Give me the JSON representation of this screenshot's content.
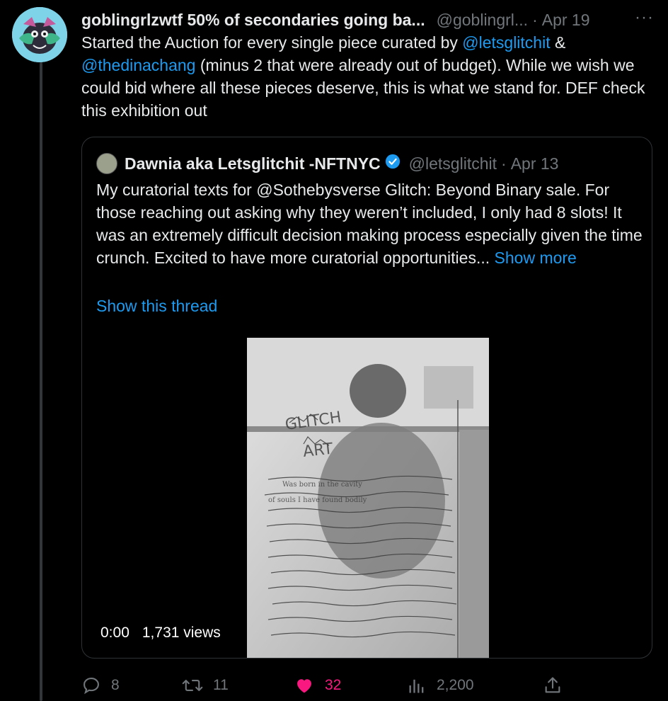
{
  "tweet": {
    "author_name": "goblingrlzwtf 50% of secondaries going ba...",
    "handle": "@goblingrl...",
    "separator": "·",
    "date": "Apr 19",
    "more_label": "···",
    "text_part1": "Started the Auction for every single piece curated by ",
    "mention1": "@letsglitchit",
    "text_part2": " & ",
    "mention2": "@thedinachang",
    "text_part3": " (minus 2 that were already out of budget).  While we wish we could bid where all these pieces deserve, this is what we stand for. DEF check this exhibition out"
  },
  "quote": {
    "author_name": "Dawnia aka Letsglitchit -NFTNYC",
    "handle": "@letsglitchit",
    "separator": "·",
    "date": "Apr 13",
    "text": "My curatorial texts for @Sothebysverse Glitch: Beyond Binary sale. For those reaching out asking why they weren’t included, I only had 8 slots! It was an extremely difficult decision making process especially given the time crunch. Excited to have more curatorial opportunities...",
    "show_more": "Show more",
    "show_thread": "Show this thread",
    "media": {
      "time": "0:00",
      "views": "1,731 views",
      "handwriting": [
        "GLITCH",
        "ART",
        "Was born in the cavity",
        "of souls I have found bodily"
      ]
    }
  },
  "actions": {
    "replies": "8",
    "retweets": "11",
    "likes": "32",
    "views": "2,200"
  },
  "colors": {
    "background": "#000000",
    "text": "#e7e9ea",
    "secondary": "#71767b",
    "link": "#1d9bf0",
    "like": "#f91880",
    "border": "#2f3336"
  }
}
